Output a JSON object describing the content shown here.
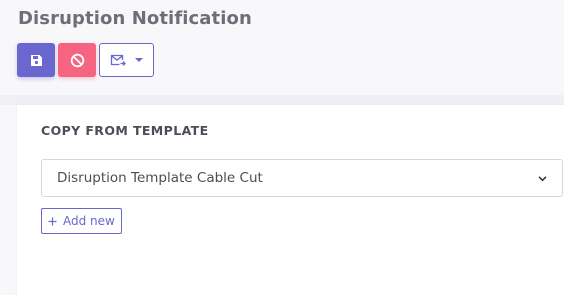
{
  "page": {
    "title": "Disruption Notification"
  },
  "toolbar": {
    "save_icon": "save-icon",
    "cancel_icon": "cancel-icon",
    "email_icon": "email-send-icon",
    "email_dropdown_icon": "caret-down-icon"
  },
  "template_section": {
    "label": "COPY FROM TEMPLATE",
    "selected_template": "Disruption Template Cable Cut",
    "dropdown_icon": "chevron-down-icon",
    "add_new_label": "Add new"
  },
  "colors": {
    "accent": "#6a67ce",
    "danger": "#f56582",
    "title": "#6e6e78",
    "text": "#4a4f57",
    "background": "#f8f8fb"
  }
}
